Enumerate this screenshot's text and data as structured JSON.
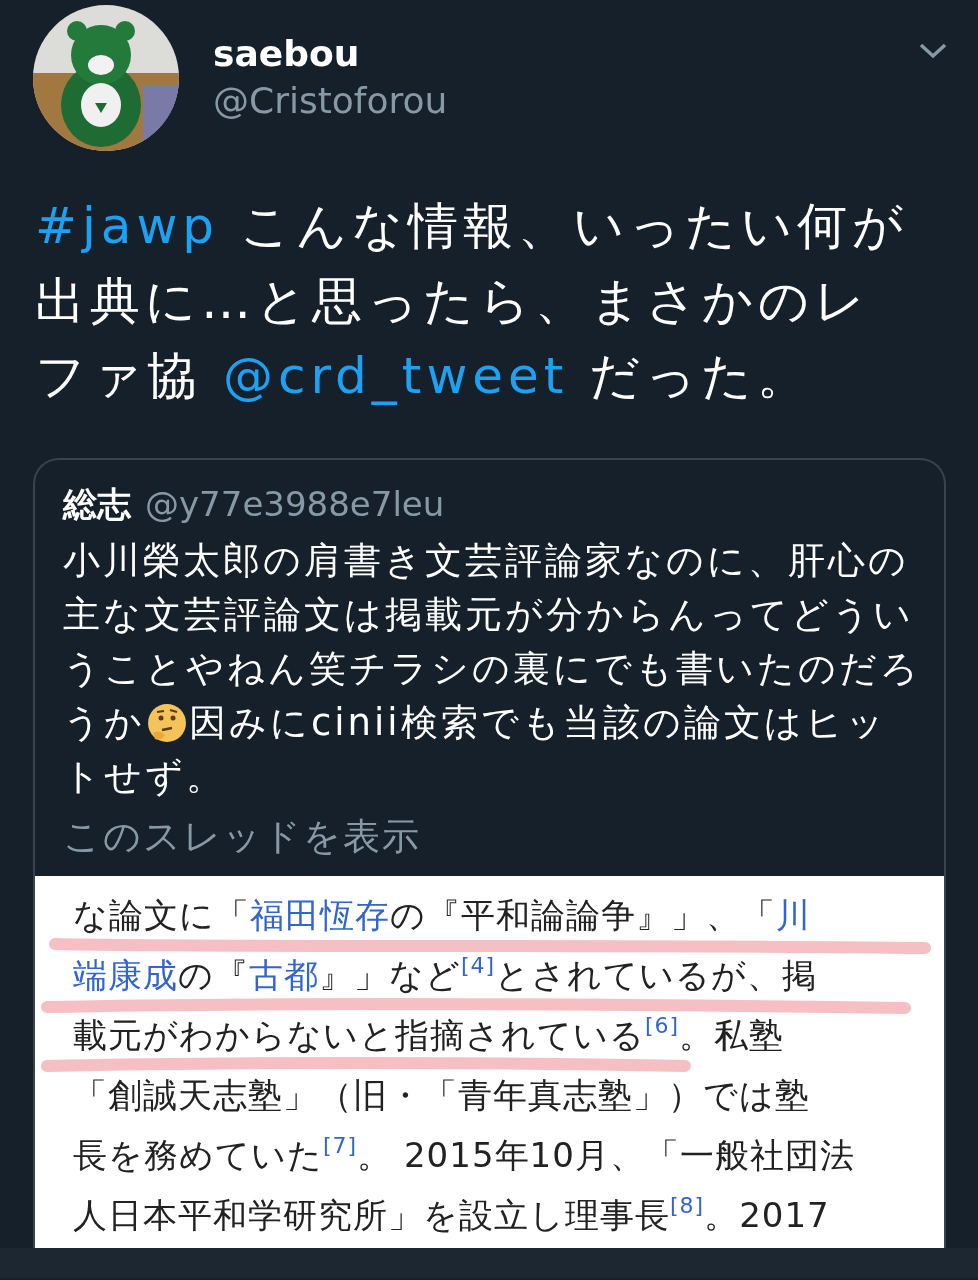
{
  "author": {
    "name": "saebou",
    "handle": "@Cristoforou"
  },
  "tweet": {
    "lines": [
      [
        {
          "kind": "hashtag",
          "text": "#jawp"
        },
        {
          "kind": "text",
          "text": " こんな情報、いったい何が"
        }
      ],
      [
        {
          "kind": "text",
          "text": "出典に…と思ったら、まさかのレ"
        }
      ],
      [
        {
          "kind": "text",
          "text": "ファ協 "
        },
        {
          "kind": "mention",
          "text": "@crd_tweet"
        },
        {
          "kind": "text",
          "text": " だった。"
        }
      ]
    ]
  },
  "quote": {
    "name": "総志",
    "handle": "@y77e3988e7leu",
    "lines": [
      [
        {
          "kind": "text",
          "text": "小川榮太郎の肩書き文芸評論家なのに、肝心の"
        }
      ],
      [
        {
          "kind": "text",
          "text": "主な文芸評論文は掲載元が分からんってどうい"
        }
      ],
      [
        {
          "kind": "text",
          "text": "うことやねん笑チラシの裏にでも書いたのだろ"
        }
      ],
      [
        {
          "kind": "text",
          "text": "うか"
        },
        {
          "kind": "emoji"
        },
        {
          "kind": "text",
          "text": "因みにcinii検索でも当該の論文はヒッ"
        }
      ],
      [
        {
          "kind": "text",
          "text": "トせず。"
        }
      ]
    ],
    "thread_link": "このスレッドを表示",
    "image": {
      "lines": [
        [
          {
            "kind": "plain",
            "text": "な論文に「"
          },
          {
            "kind": "link",
            "text": "福田恆存"
          },
          {
            "kind": "plain",
            "text": "の『平和論論争』」、「"
          },
          {
            "kind": "link",
            "text": "川"
          }
        ],
        [
          {
            "kind": "link",
            "text": "端康成"
          },
          {
            "kind": "plain",
            "text": "の『"
          },
          {
            "kind": "link",
            "text": "古都"
          },
          {
            "kind": "plain",
            "text": "』」など"
          },
          {
            "kind": "ref",
            "text": "[4]"
          },
          {
            "kind": "plain",
            "text": "とされているが、掲"
          }
        ],
        [
          {
            "kind": "plain",
            "text": "載元がわからないと指摘されている"
          },
          {
            "kind": "ref",
            "text": "[6]"
          },
          {
            "kind": "plain",
            "text": "。私塾"
          }
        ],
        [
          {
            "kind": "plain",
            "text": "「創誠天志塾」（旧・「青年真志塾」）では塾"
          }
        ],
        [
          {
            "kind": "plain",
            "text": "長を務めていた"
          },
          {
            "kind": "ref",
            "text": "[7]"
          },
          {
            "kind": "plain",
            "text": "。 2015年10月、「一般社団法"
          }
        ],
        [
          {
            "kind": "plain",
            "text": "人日本平和学研究所」を設立し理事長"
          },
          {
            "kind": "ref",
            "text": "[8]"
          },
          {
            "kind": "plain",
            "text": "。2017"
          }
        ]
      ]
    }
  }
}
